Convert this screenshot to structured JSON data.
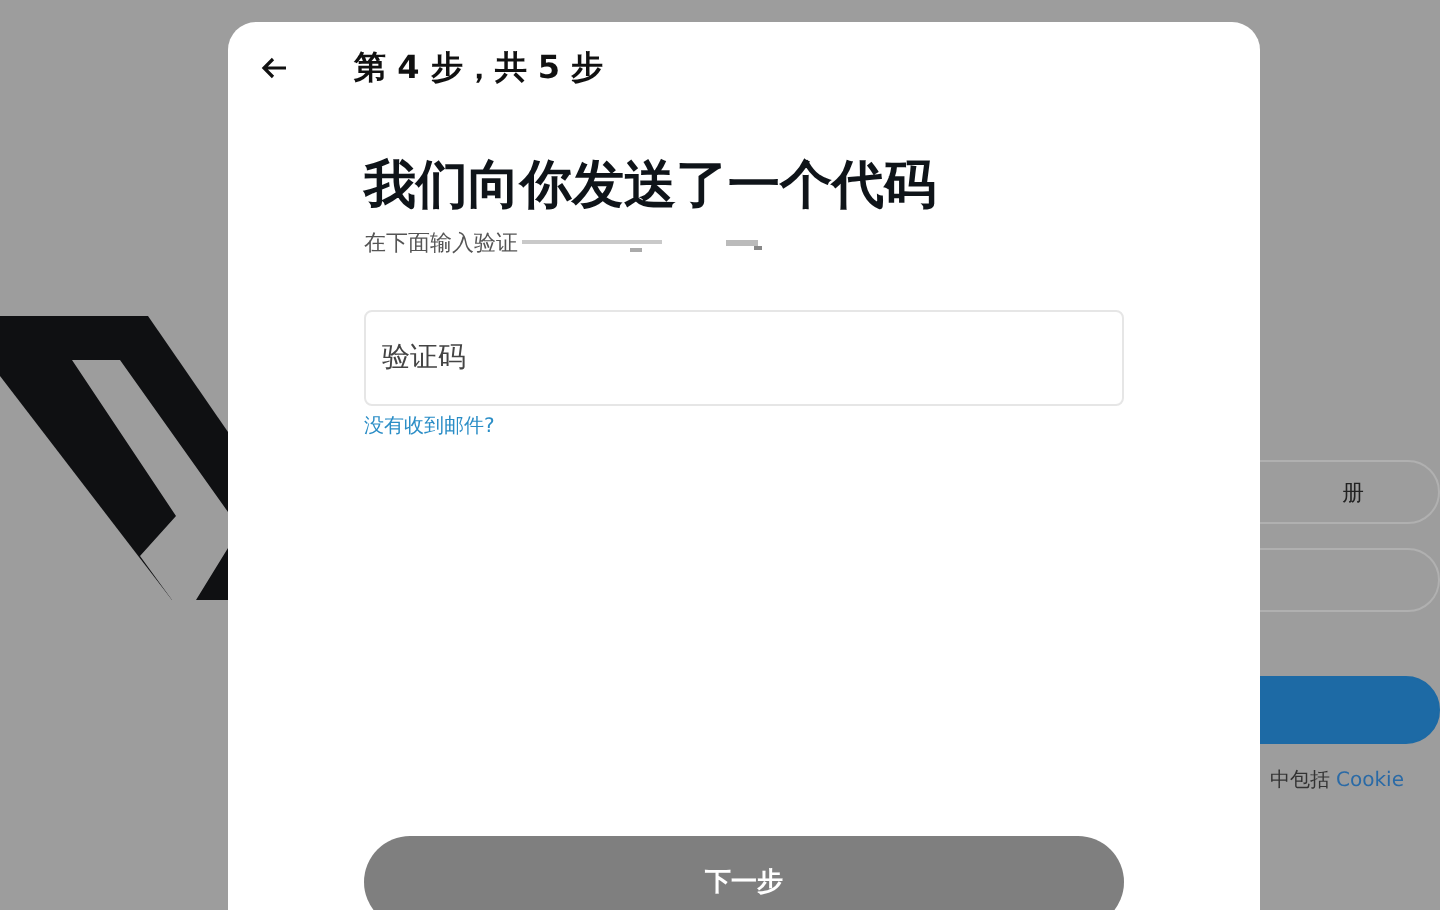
{
  "background": {
    "signup_button": "册",
    "terms": {
      "text": "中包括",
      "link": "Cookie"
    }
  },
  "dialog": {
    "step": "第 4 步，共 5 步",
    "title": "我们向你发送了一个代码",
    "subtitle": "在下面输入验证",
    "code_field": {
      "placeholder": "验证码"
    },
    "resend_link": "没有收到邮件?",
    "next_button": {
      "label": "下一步",
      "disabled": true
    }
  }
}
